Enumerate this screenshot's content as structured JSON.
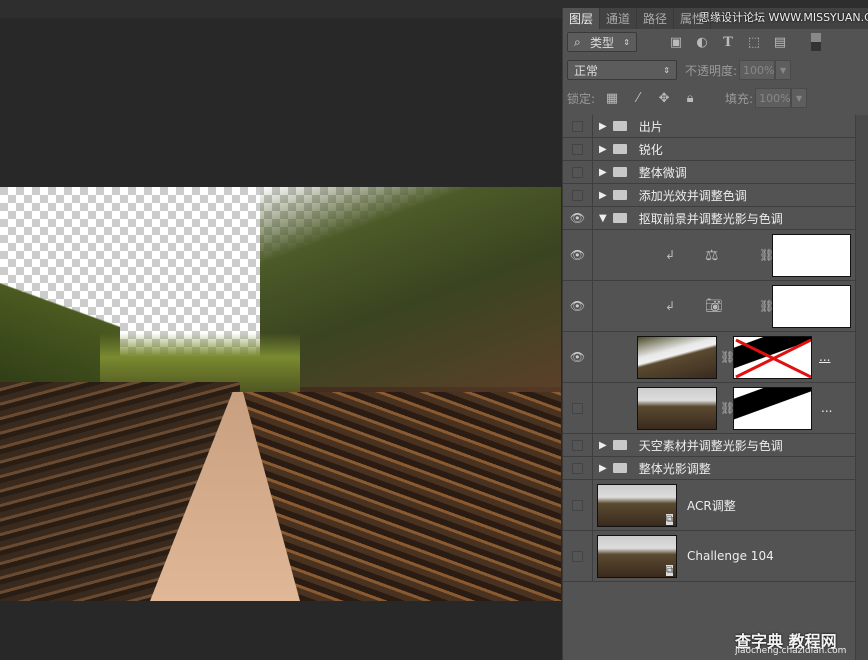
{
  "panel": {
    "tabs": [
      {
        "label": "图层",
        "active": true
      },
      {
        "label": "通道"
      },
      {
        "label": "路径"
      },
      {
        "label": "属性"
      }
    ],
    "watermark": "思缘设计论坛 WWW.MISSYUAN.COM",
    "filter": {
      "label": "类型",
      "icons": [
        "image-icon",
        "adjustment-icon",
        "type-icon",
        "shape-icon",
        "smart-object-icon"
      ]
    },
    "blend": {
      "mode": "正常",
      "opacity_label": "不透明度:",
      "opacity_value": "100%"
    },
    "lock": {
      "label": "锁定:",
      "fill_label": "填充:",
      "fill_value": "100%"
    },
    "layers": [
      {
        "type": "group",
        "name": "出片",
        "visible": false,
        "expanded": false
      },
      {
        "type": "group",
        "name": "锐化",
        "visible": false,
        "expanded": false
      },
      {
        "type": "group",
        "name": "整体微调",
        "visible": false,
        "expanded": false
      },
      {
        "type": "group",
        "name": "添加光效并调整色调",
        "visible": false,
        "expanded": false
      },
      {
        "type": "group",
        "name": "抠取前景并调整光影与色调",
        "visible": true,
        "expanded": true
      },
      {
        "type": "adjustment",
        "icon": "balance-icon",
        "visible": true,
        "clipped": true
      },
      {
        "type": "adjustment",
        "icon": "camera-filter-icon",
        "visible": true,
        "clipped": true
      },
      {
        "type": "masked",
        "name": "...",
        "visible": true,
        "mask_disabled": true
      },
      {
        "type": "masked",
        "name": "...",
        "visible": false
      },
      {
        "type": "group",
        "name": "天空素材并调整光影与色调",
        "visible": false,
        "expanded": false
      },
      {
        "type": "group",
        "name": "整体光影调整",
        "visible": false,
        "expanded": false
      },
      {
        "type": "smart",
        "name": "ACR调整",
        "visible": false
      },
      {
        "type": "smart",
        "name": "Challenge 104",
        "visible": false
      }
    ]
  },
  "site_watermark": {
    "title": "查字典 教程网",
    "url": "jiaocheng.chazidian.com"
  },
  "colors": {
    "panel": "#535353",
    "canvas_bg": "#282828",
    "mask_cross": "#e01010"
  }
}
